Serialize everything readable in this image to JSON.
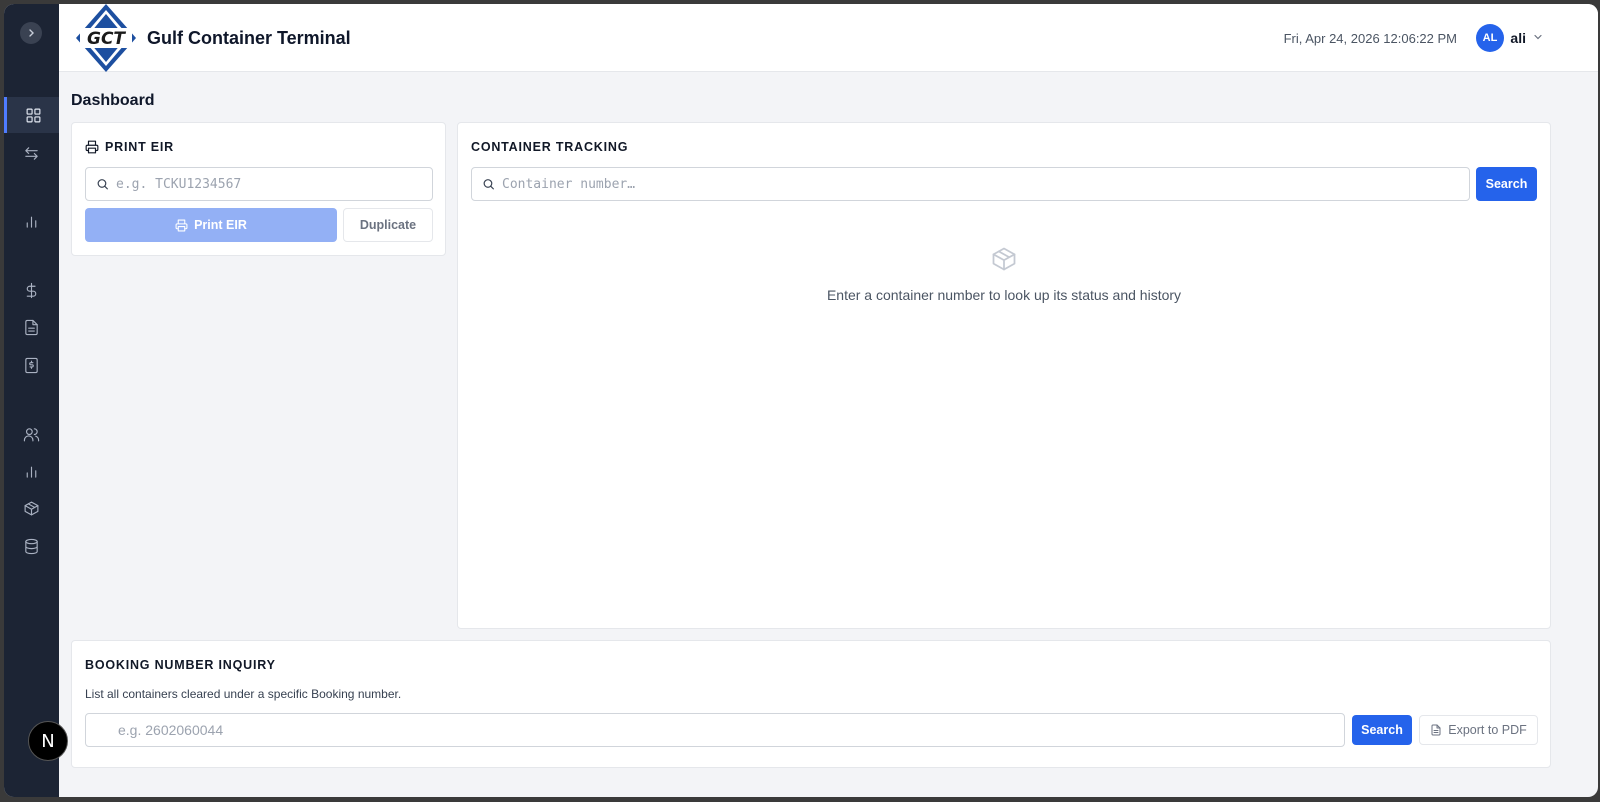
{
  "header": {
    "app_title": "Gulf Container Terminal",
    "logo_text": "GCT",
    "datetime": "Fri, Apr 24, 2026 12:06:22 PM",
    "user": {
      "initials": "AL",
      "name": "ali"
    }
  },
  "sidebar": {
    "items": [
      {
        "icon": "dashboard-icon",
        "active": true
      },
      {
        "icon": "transfer-arrows-icon",
        "active": false
      },
      {
        "icon": "bar-chart-icon",
        "active": false
      },
      {
        "icon": "dollar-icon",
        "active": false
      },
      {
        "icon": "document-icon",
        "active": false
      },
      {
        "icon": "invoice-icon",
        "active": false
      },
      {
        "icon": "users-icon",
        "active": false
      },
      {
        "icon": "bar-chart-icon",
        "active": false
      },
      {
        "icon": "package-icon",
        "active": false
      },
      {
        "icon": "database-icon",
        "active": false
      }
    ],
    "badge_letter": "N"
  },
  "page": {
    "title": "Dashboard"
  },
  "print_eir": {
    "title": "PRINT EIR",
    "placeholder": "e.g. TCKU1234567",
    "print_label": "Print EIR",
    "duplicate_label": "Duplicate"
  },
  "container_tracking": {
    "title": "CONTAINER TRACKING",
    "placeholder": "Container number…",
    "search_label": "Search",
    "empty_message": "Enter a container number to look up its status and history"
  },
  "booking_inquiry": {
    "title": "BOOKING NUMBER INQUIRY",
    "description": "List all containers cleared under a specific Booking number.",
    "placeholder": "e.g. 2602060044",
    "search_label": "Search",
    "export_label": "Export to PDF"
  },
  "colors": {
    "sidebar_bg": "#1c2434",
    "primary": "#2563eb",
    "primary_disabled": "#93b0f5",
    "page_bg": "#f3f4f7"
  }
}
